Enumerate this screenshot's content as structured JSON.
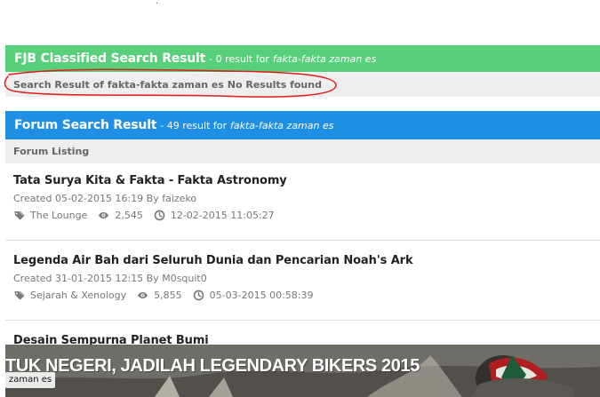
{
  "fjb_result": {
    "title": "FJB Classified Search Result",
    "meta": "- 0 result for",
    "query": "fakta-fakta zaman es",
    "message": "Search Result of fakta-fakta zaman es No Results found"
  },
  "forum_result": {
    "title": "Forum Search Result",
    "meta": "- 49 result for",
    "query": "fakta-fakta zaman es",
    "listing_label": "Forum Listing"
  },
  "threads": [
    {
      "title": "Tata Surya Kita & Fakta - Fakta Astronomy",
      "created": "Created 05-02-2015 16:19 By faizeko",
      "category_icon": "tags-icon",
      "category": "The Lounge",
      "views_icon": "eye-icon",
      "views": "2,545",
      "updated_icon": "clock-icon",
      "updated": "12-02-2015 11:05:27"
    },
    {
      "title": "Legenda Air Bah dari Seluruh Dunia dan Pencarian Noah's Ark",
      "created": "Created 31-01-2015 12:15 By M0squit0",
      "category_icon": "tags-icon",
      "category": "Sejarah & Xenology",
      "views_icon": "eye-icon",
      "views": "5,855",
      "updated_icon": "clock-icon",
      "updated": "05-03-2015 00:58:39"
    },
    {
      "title": "Desain Sempurna Planet Bumi"
    }
  ],
  "banner": {
    "text": "TUK NEGERI, JADILAH LEGENDARY BIKERS 2015",
    "search_tag": "zaman es"
  },
  "colors": {
    "fjb_header": "#58cf7b",
    "forum_header": "#1f8fe6",
    "subbar_background": "#eeeeee",
    "annotation_red": "#e21b1b"
  }
}
